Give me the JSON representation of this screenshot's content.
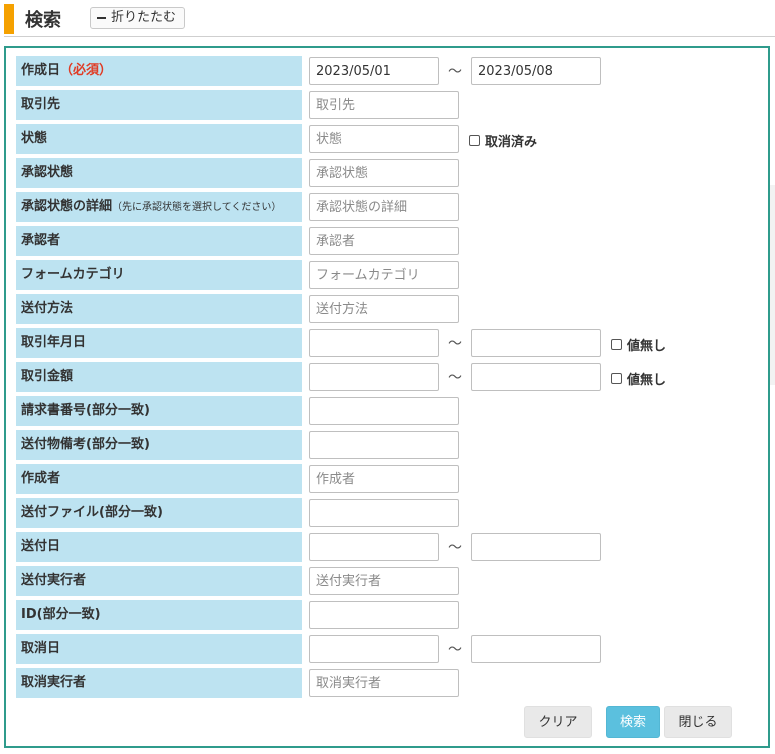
{
  "header": {
    "title": "検索",
    "fold_label": "折りたたむ"
  },
  "fields": {
    "created_date": {
      "label": "作成日",
      "required": "（必須）",
      "from": "2023/05/01",
      "to": "2023/05/08"
    },
    "partner": {
      "label": "取引先",
      "placeholder": "取引先"
    },
    "status": {
      "label": "状態",
      "placeholder": "状態",
      "checkbox": "取消済み"
    },
    "approval_status": {
      "label": "承認状態",
      "placeholder": "承認状態"
    },
    "approval_detail": {
      "label": "承認状態の詳細",
      "note": "（先に承認状態を選択してください）",
      "placeholder": "承認状態の詳細"
    },
    "approver": {
      "label": "承認者",
      "placeholder": "承認者"
    },
    "form_category": {
      "label": "フォームカテゴリ",
      "placeholder": "フォームカテゴリ"
    },
    "send_method": {
      "label": "送付方法",
      "placeholder": "送付方法"
    },
    "transaction_date": {
      "label": "取引年月日",
      "checkbox": "値無し"
    },
    "transaction_amount": {
      "label": "取引金額",
      "checkbox": "値無し"
    },
    "invoice_number": {
      "label": "請求書番号(部分一致)"
    },
    "send_note": {
      "label": "送付物備考(部分一致)"
    },
    "creator": {
      "label": "作成者",
      "placeholder": "作成者"
    },
    "send_file": {
      "label": "送付ファイル(部分一致)"
    },
    "send_date": {
      "label": "送付日"
    },
    "sender": {
      "label": "送付実行者",
      "placeholder": "送付実行者"
    },
    "id": {
      "label": "ID(部分一致)"
    },
    "cancel_date": {
      "label": "取消日"
    },
    "canceller": {
      "label": "取消実行者",
      "placeholder": "取消実行者"
    }
  },
  "range_separator": "〜",
  "buttons": {
    "clear": "クリア",
    "search": "検索",
    "close": "閉じる"
  }
}
